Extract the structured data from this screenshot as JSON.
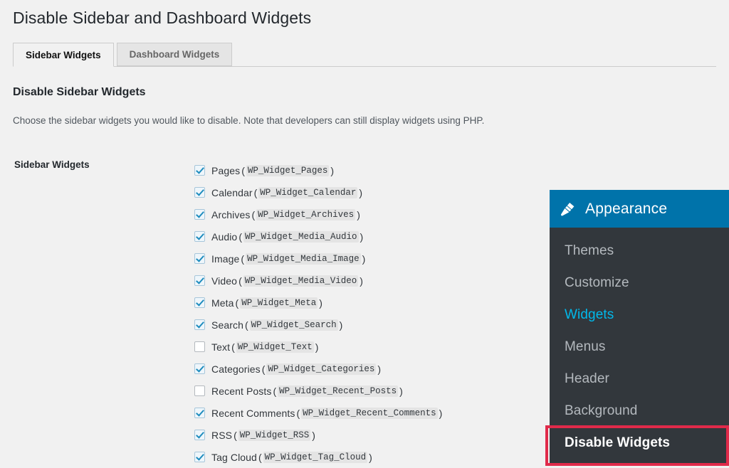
{
  "page": {
    "title": "Disable Sidebar and Dashboard Widgets"
  },
  "tabs": [
    {
      "label": "Sidebar Widgets",
      "active": true
    },
    {
      "label": "Dashboard Widgets",
      "active": false
    }
  ],
  "section": {
    "heading": "Disable Sidebar Widgets",
    "description": "Choose the sidebar widgets you would like to disable. Note that developers can still display widgets using PHP."
  },
  "form": {
    "field_label": "Sidebar Widgets",
    "widgets": [
      {
        "label": "Pages",
        "class_name": "WP_Widget_Pages",
        "checked": true
      },
      {
        "label": "Calendar",
        "class_name": "WP_Widget_Calendar",
        "checked": true
      },
      {
        "label": "Archives",
        "class_name": "WP_Widget_Archives",
        "checked": true
      },
      {
        "label": "Audio",
        "class_name": "WP_Widget_Media_Audio",
        "checked": true
      },
      {
        "label": "Image",
        "class_name": "WP_Widget_Media_Image",
        "checked": true
      },
      {
        "label": "Video",
        "class_name": "WP_Widget_Media_Video",
        "checked": true
      },
      {
        "label": "Meta",
        "class_name": "WP_Widget_Meta",
        "checked": true
      },
      {
        "label": "Search",
        "class_name": "WP_Widget_Search",
        "checked": true
      },
      {
        "label": "Text",
        "class_name": "WP_Widget_Text",
        "checked": false
      },
      {
        "label": "Categories",
        "class_name": "WP_Widget_Categories",
        "checked": true
      },
      {
        "label": "Recent Posts",
        "class_name": "WP_Widget_Recent_Posts",
        "checked": false
      },
      {
        "label": "Recent Comments",
        "class_name": "WP_Widget_Recent_Comments",
        "checked": true
      },
      {
        "label": "RSS",
        "class_name": "WP_Widget_RSS",
        "checked": true
      },
      {
        "label": "Tag Cloud",
        "class_name": "WP_Widget_Tag_Cloud",
        "checked": true
      }
    ]
  },
  "admin_menu": {
    "header": {
      "label": "Appearance",
      "icon": "paintbrush-icon",
      "background": "#0073aa"
    },
    "items": [
      {
        "label": "Themes",
        "state": "normal"
      },
      {
        "label": "Customize",
        "state": "normal"
      },
      {
        "label": "Widgets",
        "state": "current"
      },
      {
        "label": "Menus",
        "state": "normal"
      },
      {
        "label": "Header",
        "state": "normal"
      },
      {
        "label": "Background",
        "state": "normal"
      },
      {
        "label": "Disable Widgets",
        "state": "highlighted"
      }
    ],
    "background": "#32373c",
    "current_color": "#00b9eb"
  },
  "callout": {
    "color": "#e02a4a",
    "target": "Disable Widgets"
  }
}
